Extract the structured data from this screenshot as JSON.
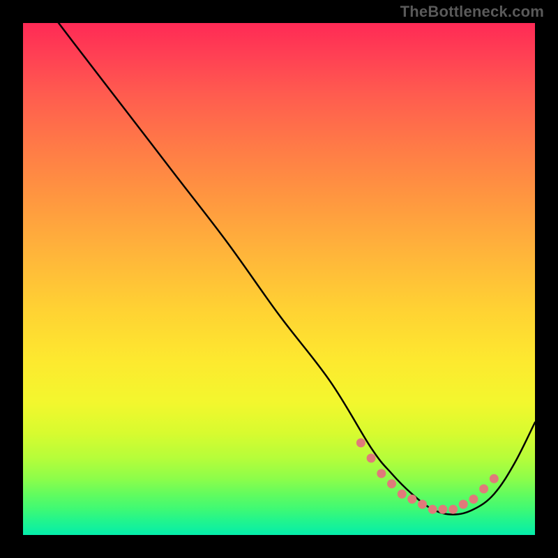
{
  "watermark": "TheBottleneck.com",
  "chart_data": {
    "type": "line",
    "title": "",
    "xlabel": "",
    "ylabel": "",
    "xlim": [
      0,
      100
    ],
    "ylim": [
      0,
      100
    ],
    "series": [
      {
        "name": "curve",
        "x": [
          0,
          4,
          10,
          20,
          30,
          40,
          50,
          60,
          68,
          72,
          76,
          80,
          84,
          88,
          92,
          96,
          100
        ],
        "values": [
          110,
          104,
          96,
          83,
          70,
          57,
          43,
          30,
          17,
          12,
          8,
          5,
          4,
          5,
          8,
          14,
          22
        ]
      }
    ],
    "markers": {
      "name": "highlight-dots",
      "color": "#e07a7a",
      "x": [
        66,
        68,
        70,
        72,
        74,
        76,
        78,
        80,
        82,
        84,
        86,
        88,
        90,
        92
      ],
      "values": [
        18,
        15,
        12,
        10,
        8,
        7,
        6,
        5,
        5,
        5,
        6,
        7,
        9,
        11
      ]
    }
  }
}
